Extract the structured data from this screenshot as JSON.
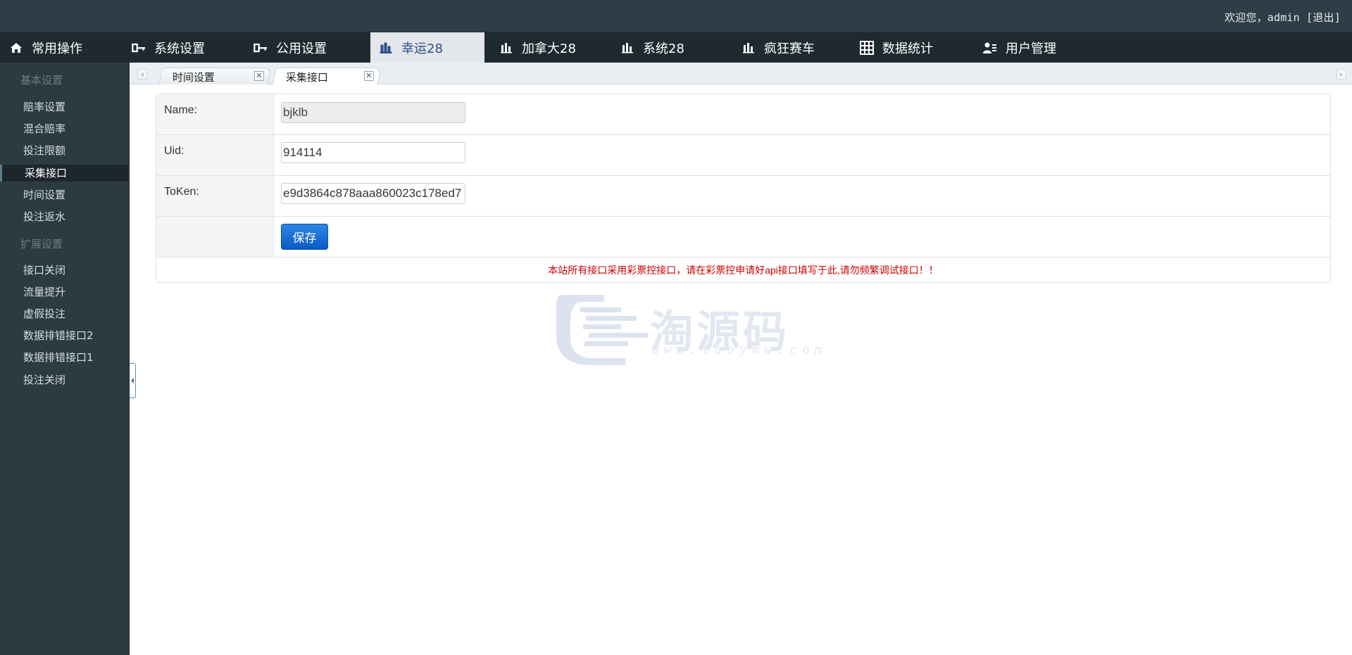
{
  "header": {
    "welcome_text": "欢迎您，admin ",
    "logout_label": "[退出]"
  },
  "nav": {
    "items": [
      {
        "label": "常用操作",
        "icon": "home-icon"
      },
      {
        "label": "系统设置",
        "icon": "key-icon"
      },
      {
        "label": "公用设置",
        "icon": "key-icon"
      },
      {
        "label": "幸运28",
        "icon": "bar-chart-icon",
        "active": true
      },
      {
        "label": "加拿大28",
        "icon": "bar-chart-icon"
      },
      {
        "label": "系统28",
        "icon": "bar-chart-icon"
      },
      {
        "label": "疯狂赛车",
        "icon": "bar-chart-icon"
      },
      {
        "label": "数据统计",
        "icon": "grid-icon"
      },
      {
        "label": "用户管理",
        "icon": "user-list-icon"
      }
    ]
  },
  "sidebar": {
    "groups": [
      {
        "title": "基本设置",
        "items": [
          "赔率设置",
          "混合赔率",
          "投注限额",
          "采集接口",
          "时间设置",
          "投注返水"
        ]
      },
      {
        "title": "扩展设置",
        "items": [
          "接口关闭",
          "流量提升",
          "虚假投注",
          "数据排错接口2",
          "数据排错接口1",
          "投注关闭"
        ]
      }
    ],
    "active_item": "采集接口"
  },
  "tabs": {
    "items": [
      {
        "label": "时间设置",
        "close": "✕"
      },
      {
        "label": "采集接口",
        "close": "✕",
        "active": true
      }
    ]
  },
  "form": {
    "name_label": "Name:",
    "name_value": "bjklb",
    "uid_label": "Uid:",
    "uid_value": "914114",
    "token_label": "ToKen:",
    "token_value": "e9d3864c878aaa860023c178ed7",
    "save_label": "保存",
    "notice": "本站所有接口采用彩票控接口，请在彩票控申请好api接口填写于此,请勿频繁调试接口！！"
  },
  "watermark": {
    "text": "淘源码",
    "url": "www.taoymw.com"
  },
  "colors": {
    "topbar": "#2f3d46",
    "nav": "#1f2a30",
    "sidebar": "#2c3a42",
    "active_nav_text": "#2f4d8c",
    "notice": "#cc0000",
    "save_button": "#0a5ac4"
  }
}
